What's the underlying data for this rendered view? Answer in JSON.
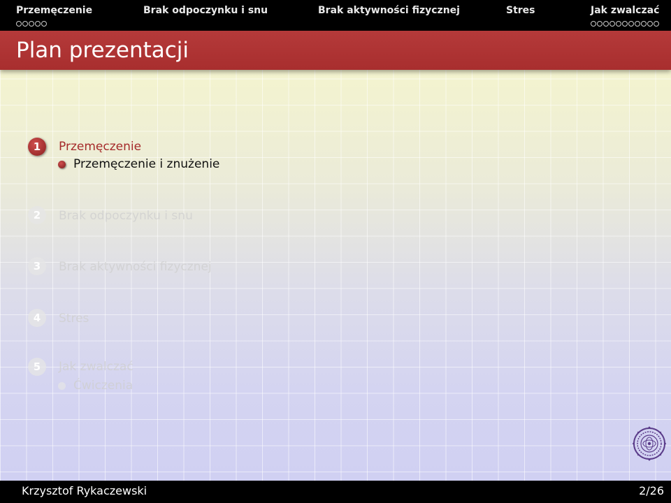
{
  "nav": {
    "sections": [
      {
        "label": "Przemęczenie",
        "dots": 5
      },
      {
        "label": "Brak odpoczynku i snu",
        "dots": 0
      },
      {
        "label": "Brak aktywności fizycznej",
        "dots": 0
      },
      {
        "label": "Stres",
        "dots": 0
      },
      {
        "label": "Jak zwalczać",
        "dots": 11
      }
    ]
  },
  "slide": {
    "title": "Plan prezentacji"
  },
  "toc": {
    "sections": [
      {
        "number": "1",
        "label": "Przemęczenie",
        "subsections": [
          "Przemęczenie i znużenie"
        ]
      },
      {
        "number": "2",
        "label": "Brak odpoczynku i snu",
        "subsections": []
      },
      {
        "number": "3",
        "label": "Brak aktywności fizycznej",
        "subsections": []
      },
      {
        "number": "4",
        "label": "Stres",
        "subsections": []
      },
      {
        "number": "5",
        "label": "Jak zwalczać",
        "subsections": [
          "Ćwiczenia"
        ]
      }
    ]
  },
  "footer": {
    "author": "Krzysztof Rykaczewski",
    "page": "2/26"
  },
  "colors": {
    "accent": "#a52a2a",
    "titlebar": "#b03434"
  }
}
